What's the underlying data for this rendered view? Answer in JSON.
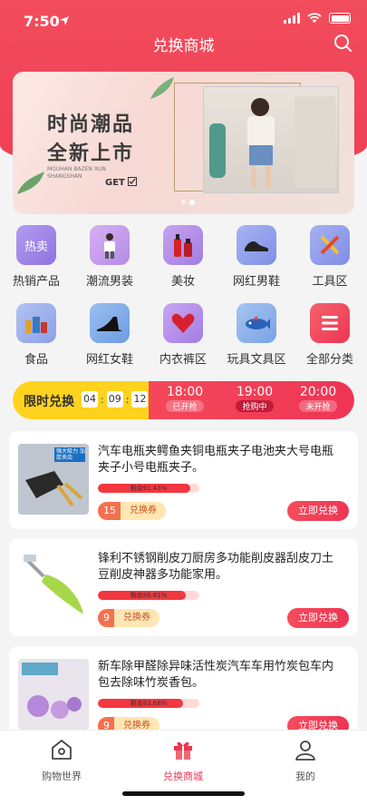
{
  "status": {
    "time": "7:50",
    "location_icon": "location-arrow-icon"
  },
  "header": {
    "title": "兑换商城",
    "search_icon": "search-icon"
  },
  "banner": {
    "line1": "时尚潮品",
    "line2": "全新上市",
    "sub": "MOUHAN BAZEN XUN SHANGSHAN",
    "cta": "GET",
    "active_dot": 1,
    "dot_count": 2
  },
  "categories": [
    {
      "label": "热销产品",
      "icon": "hot-sale-icon",
      "color": "#a98ce8"
    },
    {
      "label": "潮流男装",
      "icon": "mens-fashion-icon",
      "color": "#c99ef0"
    },
    {
      "label": "美妆",
      "icon": "cosmetics-icon",
      "color": "#b78de6"
    },
    {
      "label": "网红男鞋",
      "icon": "mens-shoes-icon",
      "color": "#8fa1ee"
    },
    {
      "label": "工具区",
      "icon": "tools-icon",
      "color": "#8d9ceb"
    },
    {
      "label": "食品",
      "icon": "food-icon",
      "color": "#9ab0ef"
    },
    {
      "label": "网红女鞋",
      "icon": "womens-shoes-icon",
      "color": "#7aa7e6"
    },
    {
      "label": "内衣裤区",
      "icon": "underwear-icon",
      "color": "#b38fe9"
    },
    {
      "label": "玩具文具区",
      "icon": "toys-icon",
      "color": "#8fb3ee"
    },
    {
      "label": "全部分类",
      "icon": "all-categories-icon",
      "color": "#ef4a5a"
    }
  ],
  "flash_sale": {
    "title": "限时兑换",
    "timer": [
      "04",
      "09",
      "12"
    ],
    "slots": [
      {
        "time": "18:00",
        "status": "已开抢"
      },
      {
        "time": "19:00",
        "status": "抢购中"
      },
      {
        "time": "20:00",
        "status": "未开抢"
      }
    ],
    "active_slot": 1
  },
  "products": [
    {
      "title": "汽车电瓶夹鳄鱼夹铜电瓶夹子电池夹大号电瓶夹子小号电瓶夹子。",
      "remaining": "剩余91.43%",
      "remaining_value": 0.9143,
      "points": "15",
      "points_label": "兑换券",
      "button": "立即兑换",
      "image_caption": "强大吸力 加厚夹齿"
    },
    {
      "title": "锋利不锈钢削皮刀厨房多功能削皮器刮皮刀土豆削皮神器多功能家用。",
      "remaining": "剩余86.61%",
      "remaining_value": 0.8661,
      "points": "9",
      "points_label": "兑换券",
      "button": "立即兑换"
    },
    {
      "title": "新车除甲醛除异味活性炭汽车车用竹炭包车内包去除味竹炭香包。",
      "remaining": "剩余83.68%",
      "remaining_value": 0.8368,
      "points": "9",
      "points_label": "兑换券",
      "button": "立即兑换"
    }
  ],
  "tabs": [
    {
      "label": "购物世界",
      "icon": "home-icon"
    },
    {
      "label": "兑换商城",
      "icon": "gift-icon"
    },
    {
      "label": "我的",
      "icon": "user-icon"
    }
  ],
  "active_tab": 1,
  "colors": {
    "brand": "#ee3554",
    "flash_yellow": "#ffd21d"
  }
}
